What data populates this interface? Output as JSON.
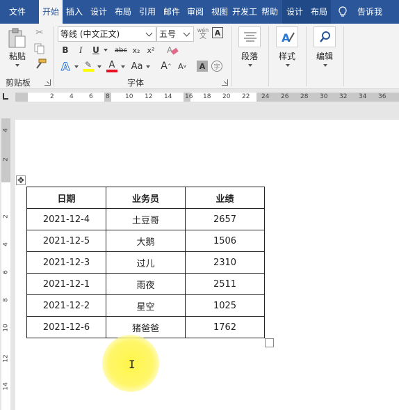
{
  "tabs": [
    "文件",
    "开始",
    "插入",
    "设计",
    "布局",
    "引用",
    "邮件",
    "审阅",
    "视图",
    "开发工",
    "帮助",
    "设计",
    "布局",
    "告诉我"
  ],
  "ribbon": {
    "clipboard": {
      "paste_label": "粘贴",
      "group_label": "剪贴板"
    },
    "font": {
      "font_name": "等线 (中文正文)",
      "font_size": "五号",
      "phonetic_label": "wén",
      "bold": "B",
      "italic": "I",
      "underline": "U",
      "strike": "abc",
      "subscript": "x₂",
      "superscript": "x²",
      "change_case": "Aa",
      "grow_font": "A",
      "shrink_font": "A",
      "char_shading": "A",
      "enclose_char": "字",
      "group_label": "字体"
    },
    "paragraph_label": "段落",
    "styles_label": "样式",
    "editing_label": "编辑",
    "highlight_color": "#ffff00",
    "font_color": "#e81123"
  },
  "ruler": {
    "h_numbers": [
      "2",
      "4",
      "6",
      "8",
      "10",
      "12",
      "14",
      "16",
      "18",
      "20",
      "22",
      "24",
      "26",
      "28",
      "30",
      "32",
      "34",
      "36"
    ],
    "v_numbers": [
      "4",
      "2",
      "2",
      "4",
      "6",
      "8",
      "10",
      "12",
      "14"
    ]
  },
  "table": {
    "headers": [
      "日期",
      "业务员",
      "业绩"
    ],
    "rows": [
      [
        "2021-12-4",
        "土豆哥",
        "2657"
      ],
      [
        "2021-12-5",
        "大鹅",
        "1506"
      ],
      [
        "2021-12-3",
        "过儿",
        "2310"
      ],
      [
        "2021-12-1",
        "雨夜",
        "2511"
      ],
      [
        "2021-12-2",
        "星空",
        "1025"
      ],
      [
        "2021-12-6",
        "猪爸爸",
        "1762"
      ]
    ]
  },
  "icons": [
    "clipboard-icon",
    "cut-icon",
    "copy-icon",
    "format-painter-icon",
    "clear-format-icon",
    "text-effect-icon",
    "highlighter-icon",
    "font-color-icon",
    "paragraph-icon",
    "styles-icon",
    "find-icon",
    "lightbulb-icon",
    "table-move-icon",
    "ibeam-cursor-icon"
  ]
}
